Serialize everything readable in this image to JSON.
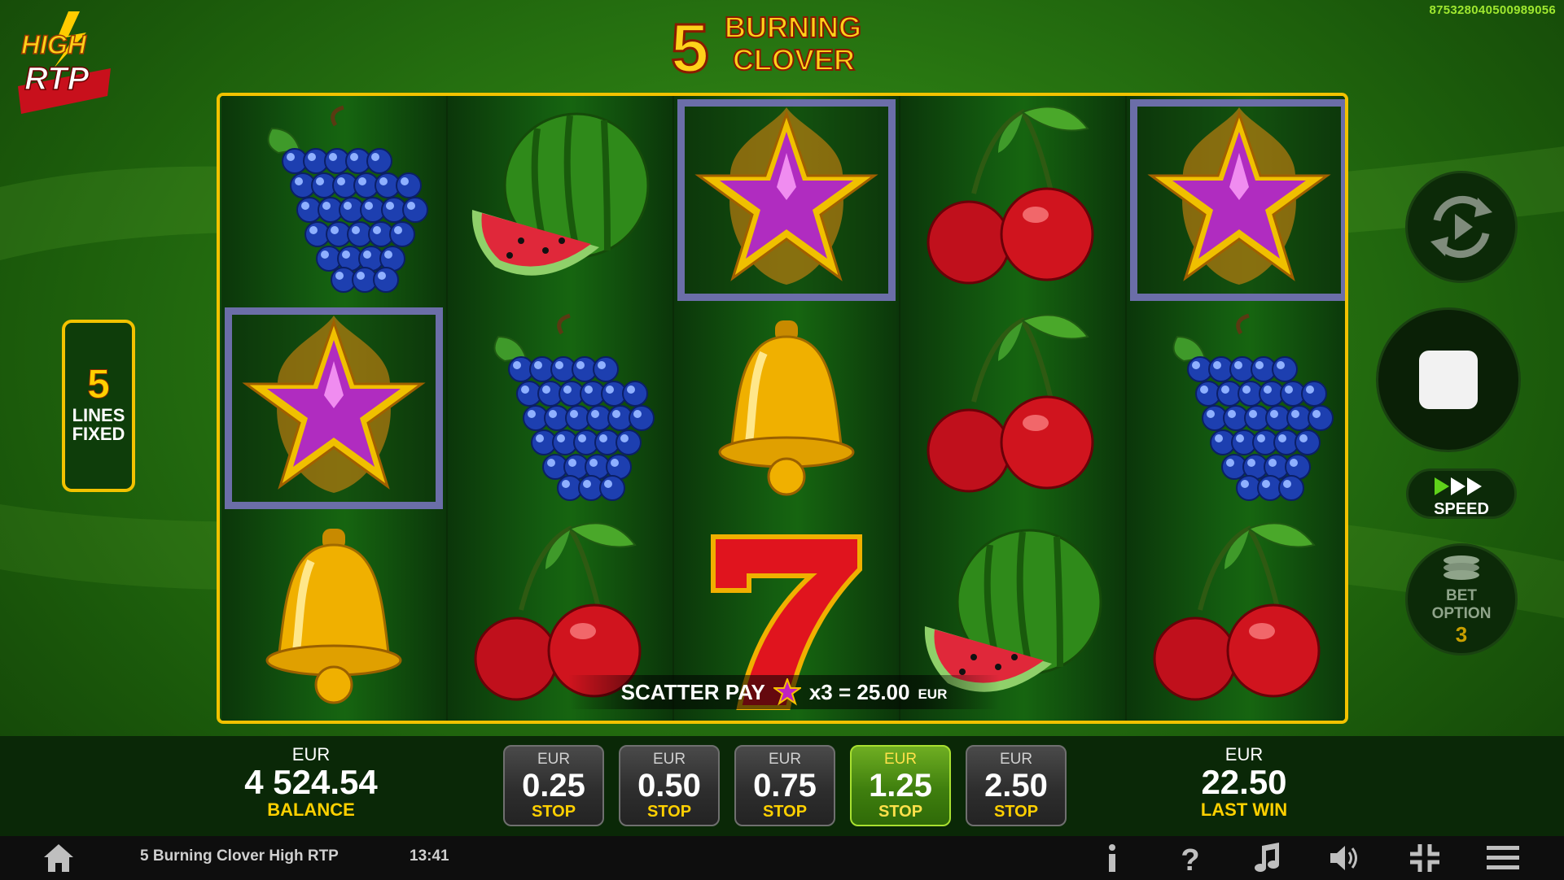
{
  "header": {
    "rtp_logo_text": [
      "HIGH",
      "RTP"
    ],
    "game_title_num": "5",
    "game_title_words": [
      "BURNING",
      "CLOVER"
    ],
    "session_id": "875328040500989056"
  },
  "lines_badge": {
    "count": "5",
    "line1": "LINES",
    "line2": "FIXED"
  },
  "reels": [
    [
      "grapes",
      "star",
      "bell"
    ],
    [
      "watermelon",
      "grapes",
      "cherries"
    ],
    [
      "star",
      "bell",
      "seven"
    ],
    [
      "cherries",
      "cherries",
      "watermelon"
    ],
    [
      "star",
      "grapes",
      "cherries"
    ]
  ],
  "highlighted_cells": [
    [
      0,
      1
    ],
    [
      2,
      0
    ],
    [
      4,
      0
    ]
  ],
  "win_message": {
    "text": "SCATTER PAY",
    "multiplier": "x3 = 25.00",
    "currency": "EUR"
  },
  "controls": {
    "autoplay_icon": "autoplay-icon",
    "spin_icon": "stop-square-icon",
    "speed_label": "SPEED",
    "bet_option_label1": "BET",
    "bet_option_label2": "OPTION",
    "bet_option_value": "3"
  },
  "balance": {
    "currency": "EUR",
    "value": "4 524.54",
    "label": "BALANCE"
  },
  "last_win": {
    "currency": "EUR",
    "value": "22.50",
    "label": "LAST WIN"
  },
  "bet_buttons": [
    {
      "currency": "EUR",
      "value": "0.25",
      "label": "STOP",
      "active": false
    },
    {
      "currency": "EUR",
      "value": "0.50",
      "label": "STOP",
      "active": false
    },
    {
      "currency": "EUR",
      "value": "0.75",
      "label": "STOP",
      "active": false
    },
    {
      "currency": "EUR",
      "value": "1.25",
      "label": "STOP",
      "active": true
    },
    {
      "currency": "EUR",
      "value": "2.50",
      "label": "STOP",
      "active": false
    }
  ],
  "status_bar": {
    "game_name": "5 Burning Clover High RTP",
    "time": "13:41",
    "icons": [
      "home-icon",
      "info-icon",
      "help-icon",
      "music-icon",
      "sound-icon",
      "fullscreen-icon",
      "menu-icon"
    ]
  },
  "colors": {
    "accent_gold": "#f2c200",
    "active_bet": "#5a9a16",
    "session_id": "#9fe830"
  }
}
